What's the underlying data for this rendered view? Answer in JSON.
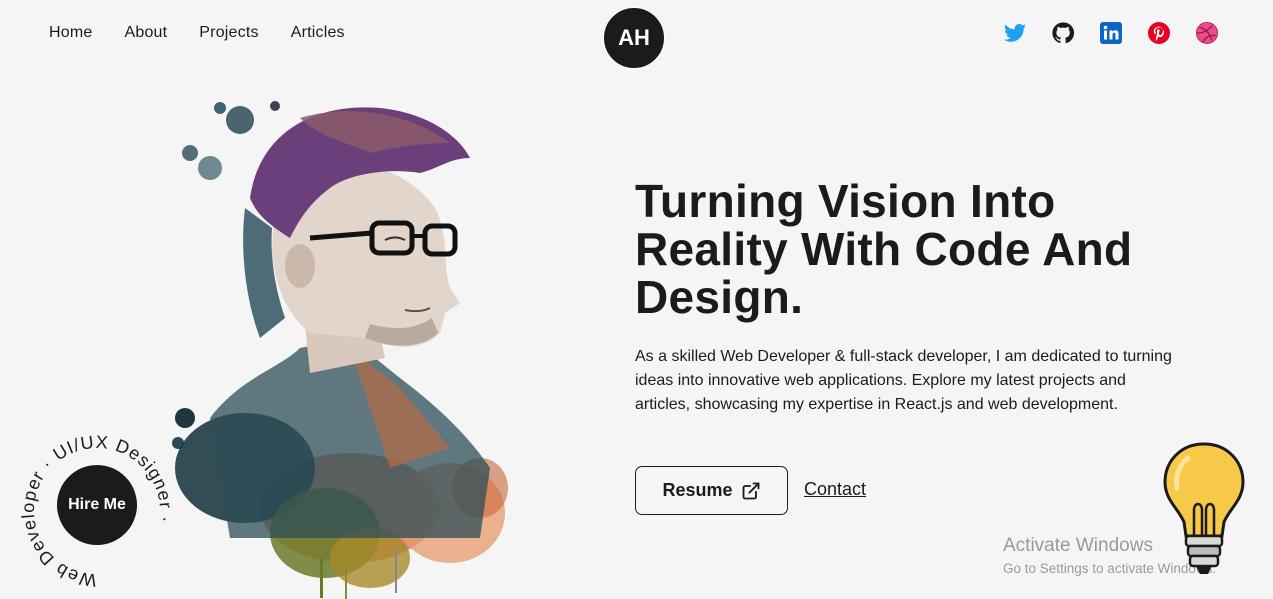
{
  "nav": {
    "links": [
      {
        "label": "Home"
      },
      {
        "label": "About"
      },
      {
        "label": "Projects"
      },
      {
        "label": "Articles"
      }
    ],
    "logo": "AH",
    "socials": [
      {
        "icon": "twitter-icon",
        "color": "#1DA1F2"
      },
      {
        "icon": "github-icon",
        "color": "#1b1b1b"
      },
      {
        "icon": "linkedin-icon",
        "color": "#0A66C2"
      },
      {
        "icon": "pinterest-icon",
        "color": "#E60023"
      },
      {
        "icon": "dribbble-icon",
        "color": "#EA4C89"
      }
    ]
  },
  "hero": {
    "headline": "Turning Vision Into Reality With Code And Design.",
    "description": "As a skilled Web Developer & full-stack developer, I am dedicated to turning ideas into innovative web applications. Explore my latest projects and articles, showcasing my expertise in React.js and web development.",
    "resume_label": "Resume",
    "contact_label": "Contact"
  },
  "hire": {
    "button_label": "Hire Me",
    "ring_text": "Web Developer · UI/UX Designer · "
  },
  "watermark": {
    "title": "Activate Windows",
    "subtitle": "Go to Settings to activate Windows."
  },
  "colors": {
    "background": "#f5f5f5",
    "dark": "#1b1b1b"
  }
}
